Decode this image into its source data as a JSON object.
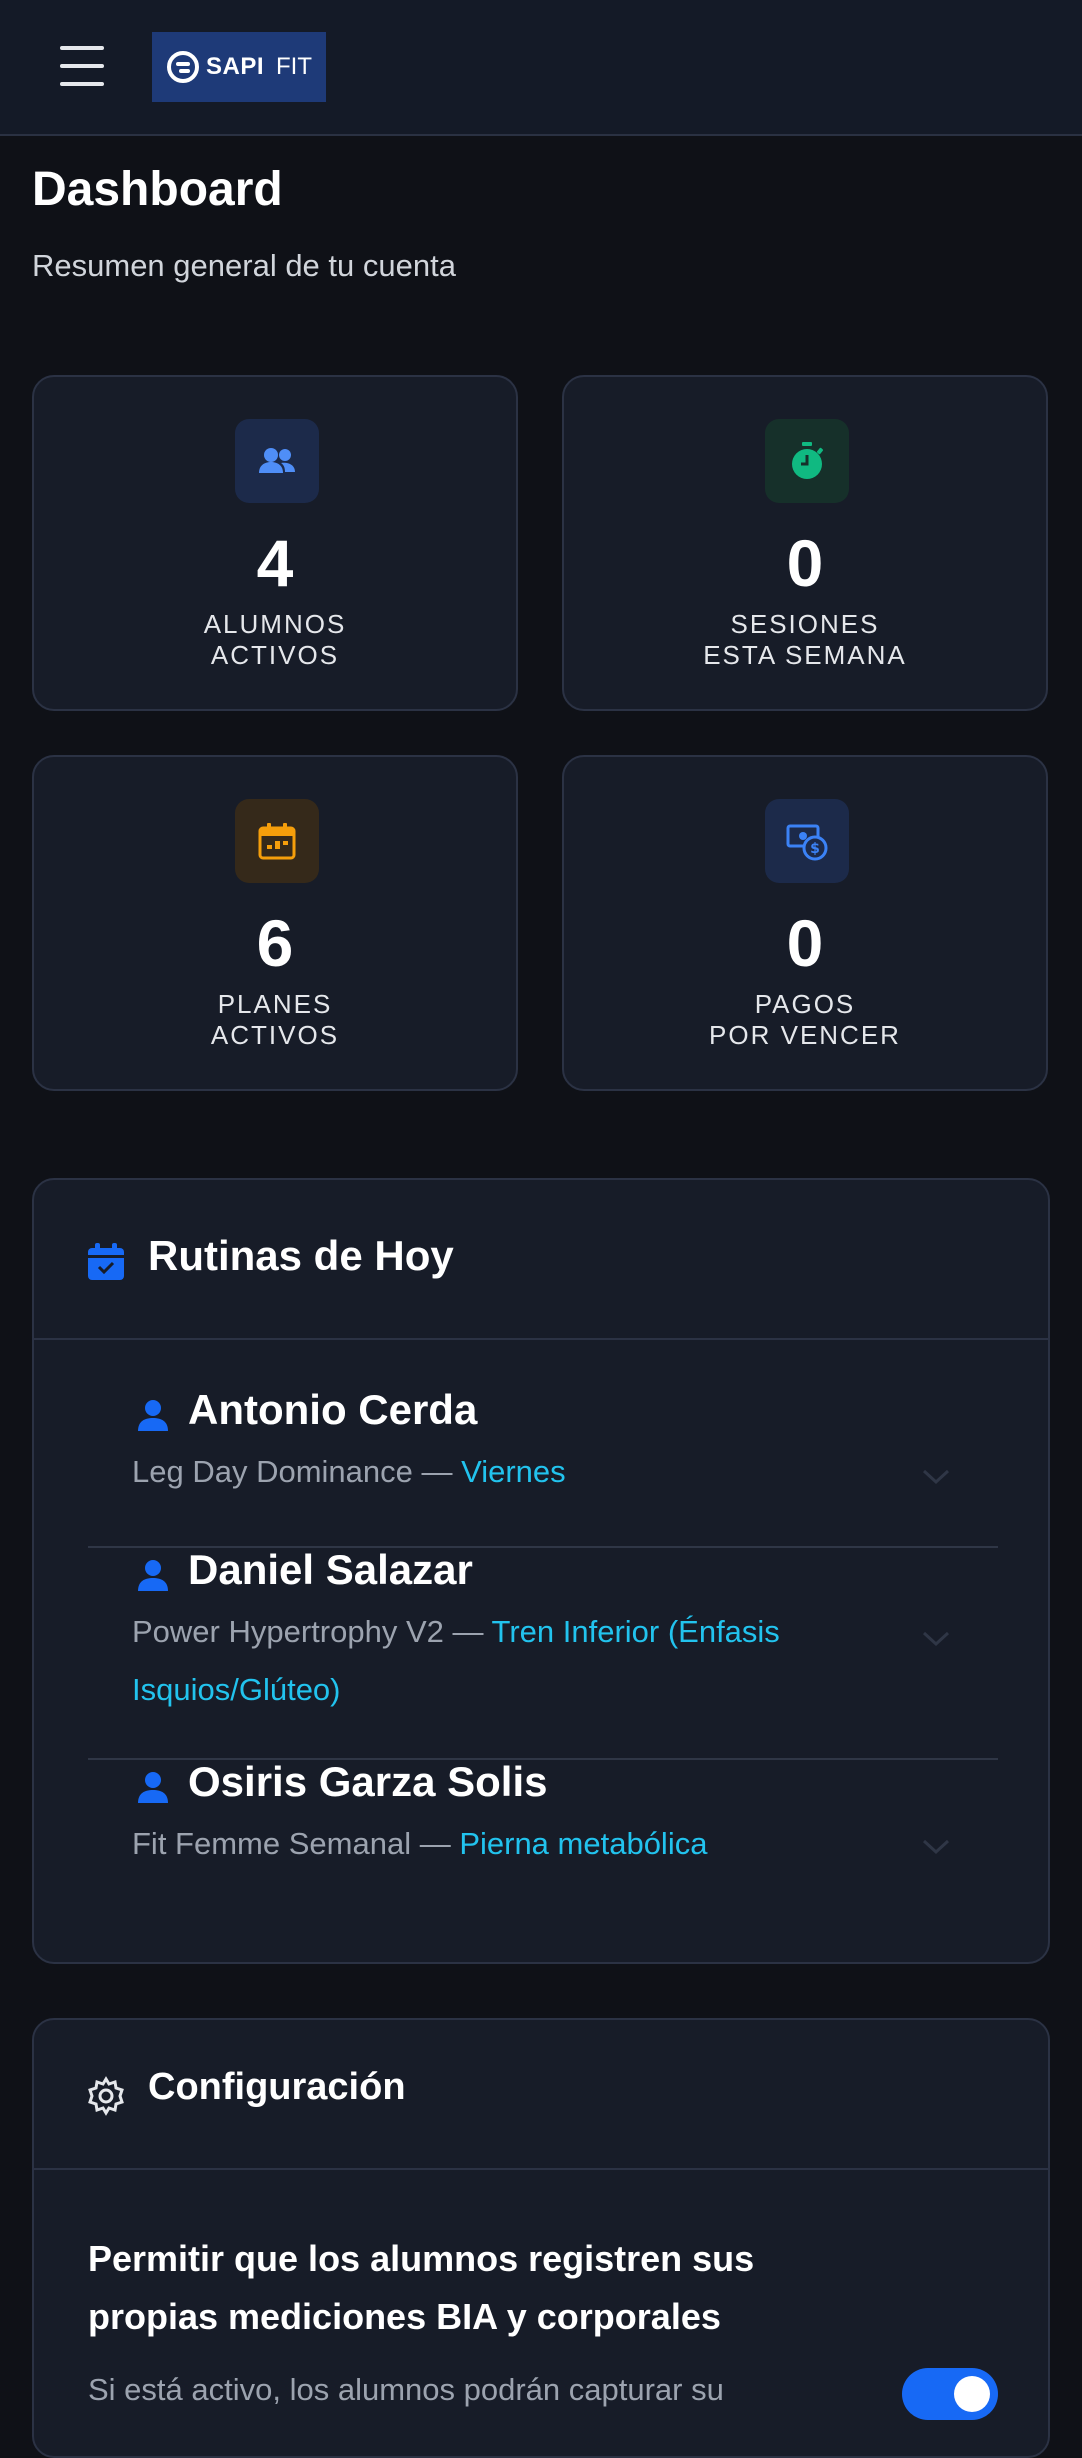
{
  "header": {
    "logo_bold": "SAPI",
    "logo_light": "FIT"
  },
  "page": {
    "title": "Dashboard",
    "subtitle": "Resumen general de tu cuenta"
  },
  "stats": [
    {
      "value": "4",
      "label_line1": "ALUMNOS",
      "label_line2": "ACTIVOS",
      "icon": "users-icon",
      "color": "#4f8ef7",
      "bg": "#1c2a4a"
    },
    {
      "value": "0",
      "label_line1": "SESIONES",
      "label_line2": "ESTA SEMANA",
      "icon": "stopwatch-icon",
      "color": "#10b981",
      "bg": "#16302a"
    },
    {
      "value": "6",
      "label_line1": "PLANES",
      "label_line2": "ACTIVOS",
      "icon": "calendar-icon",
      "color": "#f59e0b",
      "bg": "#35291a"
    },
    {
      "value": "0",
      "label_line1": "PAGOS",
      "label_line2": "POR VENCER",
      "icon": "money-icon",
      "color": "#3b82f6",
      "bg": "#1c2a4a"
    }
  ],
  "routines_card": {
    "title": "Rutinas de Hoy",
    "items": [
      {
        "name": "Antonio Cerda",
        "plan": "Leg Day Dominance — ",
        "day": "Viernes"
      },
      {
        "name": "Daniel Salazar",
        "plan": "Power Hypertrophy V2 — ",
        "day": "Tren Inferior (Énfasis Isquios/Glúteo)"
      },
      {
        "name": "Osiris Garza Solis",
        "plan": "Fit Femme Semanal — ",
        "day": "Pierna metabólica"
      }
    ]
  },
  "config_card": {
    "title": "Configuración",
    "option_title": "Permitir que los alumnos registren sus propias mediciones BIA y corporales",
    "option_desc": "Si está activo, los alumnos podrán capturar su"
  }
}
